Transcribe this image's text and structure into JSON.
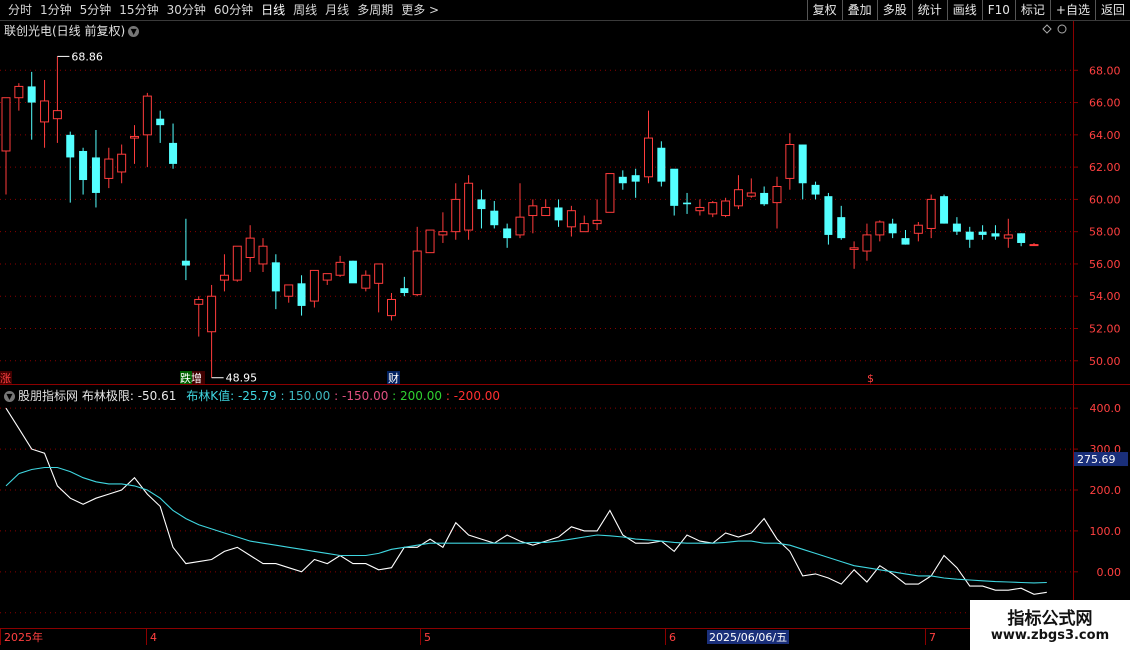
{
  "toolbar": {
    "periods": [
      "分时",
      "1分钟",
      "5分钟",
      "15分钟",
      "30分钟",
      "60分钟",
      "日线",
      "周线",
      "月线",
      "多周期",
      "更多 >"
    ],
    "active_period": "日线",
    "buttons": [
      "复权",
      "叠加",
      "多股",
      "统计",
      "画线",
      "F10",
      "标记",
      "+自选",
      "返回"
    ]
  },
  "main_title": "联创光电(日线 前复权)",
  "markers": {
    "high_label": "68.86",
    "low_label": "48.95",
    "events": [
      "涨",
      "跌增",
      "财",
      "$"
    ]
  },
  "indicator": {
    "name": "股朋指标网",
    "main_label": "布林极限: -50.61",
    "k_label": "布林K值: -25.79",
    "levels": [
      "150.00",
      "-150.00",
      "200.00",
      "-200.00"
    ],
    "current_value_tag": "275.69",
    "axis": [
      "400.0",
      "300.0",
      "200.0",
      "100.0",
      "0.00",
      "-100.0"
    ]
  },
  "date_axis": {
    "labels": [
      "2025年",
      "4",
      "5",
      "6",
      "7"
    ],
    "highlight": "2025/06/06/五"
  },
  "watermark": {
    "title": "指标公式网",
    "url": "www.zbgs3.com"
  },
  "colors": {
    "up": "#ff3c3c",
    "down": "#54ffff",
    "grid": "#8b0000",
    "line_white": "#ffffff",
    "line_cyan": "#3fd6e0"
  },
  "chart_data": [
    {
      "type": "candlestick",
      "title": "联创光电(日线 前复权)",
      "y_ticks": [
        "68.00",
        "66.00",
        "64.00",
        "62.00",
        "60.00",
        "58.00",
        "56.00",
        "54.00",
        "52.00",
        "50.00"
      ],
      "ylim": [
        48.5,
        70.0
      ],
      "ohlc": [
        [
          63.0,
          66.2,
          60.3,
          66.3
        ],
        [
          66.3,
          67.2,
          65.5,
          67.0
        ],
        [
          67.0,
          67.9,
          63.7,
          66.0
        ],
        [
          64.8,
          67.4,
          63.2,
          66.1
        ],
        [
          65.0,
          68.86,
          63.5,
          65.5
        ],
        [
          64.0,
          64.2,
          59.8,
          62.6
        ],
        [
          63.0,
          63.2,
          60.3,
          61.2
        ],
        [
          62.6,
          64.3,
          59.5,
          60.4
        ],
        [
          61.3,
          63.2,
          60.7,
          62.5
        ],
        [
          61.7,
          63.4,
          61.0,
          62.8
        ],
        [
          63.8,
          64.6,
          62.2,
          63.9
        ],
        [
          64.0,
          66.6,
          62.0,
          66.4
        ],
        [
          65.0,
          65.5,
          63.5,
          64.6
        ],
        [
          63.5,
          64.7,
          61.9,
          62.2
        ],
        [
          56.2,
          58.8,
          55.0,
          55.9
        ],
        [
          53.5,
          54.0,
          51.5,
          53.8
        ],
        [
          51.8,
          54.7,
          48.95,
          54.0
        ],
        [
          55.0,
          56.6,
          54.3,
          55.3
        ],
        [
          55.0,
          57.1,
          54.9,
          57.1
        ],
        [
          56.4,
          58.4,
          55.5,
          57.6
        ],
        [
          56.0,
          57.6,
          55.5,
          57.1
        ],
        [
          56.1,
          56.6,
          53.2,
          54.3
        ],
        [
          54.0,
          54.6,
          53.6,
          54.7
        ],
        [
          54.8,
          55.3,
          52.8,
          53.4
        ],
        [
          53.7,
          55.6,
          53.3,
          55.6
        ],
        [
          55.0,
          55.4,
          54.7,
          55.4
        ],
        [
          55.3,
          56.5,
          55.2,
          56.1
        ],
        [
          56.2,
          56.2,
          55.2,
          54.8
        ],
        [
          54.5,
          55.6,
          54.3,
          55.3
        ],
        [
          54.8,
          55.9,
          53.0,
          56.0
        ],
        [
          52.8,
          54.2,
          52.5,
          53.8
        ],
        [
          54.5,
          55.2,
          54.0,
          54.2
        ],
        [
          54.1,
          58.3,
          54.0,
          56.8
        ],
        [
          56.7,
          57.8,
          57.0,
          58.1
        ],
        [
          57.8,
          59.2,
          57.3,
          58.0
        ],
        [
          58.0,
          61.0,
          57.5,
          60.0
        ],
        [
          58.1,
          61.5,
          57.5,
          61.0
        ],
        [
          60.0,
          60.6,
          58.2,
          59.4
        ],
        [
          59.3,
          59.9,
          58.2,
          58.4
        ],
        [
          58.2,
          58.5,
          57.0,
          57.6
        ],
        [
          57.8,
          61.0,
          57.6,
          58.9
        ],
        [
          59.0,
          60.0,
          57.9,
          59.6
        ],
        [
          59.0,
          60.0,
          59.0,
          59.5
        ],
        [
          59.5,
          60.0,
          58.3,
          58.7
        ],
        [
          58.3,
          59.6,
          57.7,
          59.3
        ],
        [
          58.0,
          59.0,
          58.0,
          58.5
        ],
        [
          58.5,
          60.0,
          58.1,
          58.7
        ],
        [
          59.2,
          61.6,
          59.2,
          61.6
        ],
        [
          61.4,
          61.8,
          60.6,
          61.0
        ],
        [
          61.5,
          61.9,
          60.1,
          61.1
        ],
        [
          61.4,
          65.5,
          61.0,
          63.8
        ],
        [
          63.2,
          63.6,
          60.8,
          61.1
        ],
        [
          61.9,
          61.7,
          59.0,
          59.6
        ],
        [
          59.8,
          60.4,
          59.1,
          59.7
        ],
        [
          59.3,
          60.0,
          59.0,
          59.5
        ],
        [
          59.1,
          59.9,
          58.9,
          59.8
        ],
        [
          59.0,
          60.1,
          58.9,
          59.9
        ],
        [
          59.6,
          61.5,
          59.4,
          60.6
        ],
        [
          60.2,
          61.3,
          60.1,
          60.4
        ],
        [
          60.4,
          60.8,
          59.6,
          59.7
        ],
        [
          59.8,
          61.4,
          58.2,
          60.8
        ],
        [
          61.3,
          64.1,
          60.6,
          63.4
        ],
        [
          63.4,
          63.4,
          60.0,
          61.0
        ],
        [
          60.9,
          61.1,
          60.0,
          60.3
        ],
        [
          60.2,
          60.4,
          57.2,
          57.8
        ],
        [
          58.9,
          59.6,
          57.5,
          57.6
        ],
        [
          56.9,
          57.4,
          55.7,
          57.0
        ],
        [
          56.8,
          58.5,
          56.2,
          57.8
        ],
        [
          57.8,
          58.7,
          57.4,
          58.6
        ],
        [
          58.5,
          58.8,
          57.6,
          57.9
        ],
        [
          57.6,
          58.1,
          57.2,
          57.2
        ],
        [
          57.9,
          58.6,
          57.4,
          58.4
        ],
        [
          58.2,
          60.3,
          57.6,
          60.0
        ],
        [
          60.2,
          60.3,
          58.5,
          58.5
        ],
        [
          58.5,
          58.9,
          57.8,
          58.0
        ],
        [
          58.0,
          58.3,
          57.0,
          57.5
        ],
        [
          58.0,
          58.4,
          57.5,
          57.8
        ],
        [
          57.9,
          58.4,
          57.5,
          57.7
        ],
        [
          57.6,
          58.8,
          57.0,
          57.8
        ],
        [
          57.9,
          57.9,
          57.1,
          57.3
        ],
        [
          57.2,
          57.3,
          57.2,
          57.2
        ]
      ]
    },
    {
      "type": "line",
      "title": "布林极限 / 布林K值",
      "y_ticks": [
        "400.0",
        "300.0",
        "200.0",
        "100.0",
        "0.00",
        "-100.0"
      ],
      "ylim": [
        -130,
        420
      ],
      "series": [
        {
          "name": "布林极限",
          "color": "#ffffff",
          "values": [
            400,
            350,
            300,
            290,
            210,
            180,
            165,
            180,
            190,
            200,
            230,
            190,
            160,
            60,
            20,
            25,
            30,
            50,
            60,
            40,
            20,
            20,
            10,
            0,
            30,
            20,
            40,
            20,
            20,
            5,
            10,
            60,
            60,
            80,
            60,
            120,
            90,
            80,
            70,
            90,
            75,
            65,
            75,
            85,
            110,
            100,
            100,
            150,
            90,
            70,
            70,
            75,
            50,
            90,
            75,
            70,
            95,
            85,
            95,
            130,
            80,
            50,
            -10,
            -5,
            -15,
            -30,
            5,
            -25,
            15,
            -5,
            -30,
            -30,
            -10,
            40,
            10,
            -35,
            -35,
            -45,
            -45,
            -40,
            -55,
            -50
          ]
        },
        {
          "name": "布林K值",
          "color": "#3fd6e0",
          "values": [
            210,
            240,
            250,
            255,
            255,
            245,
            230,
            220,
            215,
            215,
            210,
            200,
            180,
            150,
            130,
            115,
            105,
            95,
            85,
            75,
            70,
            65,
            60,
            55,
            50,
            45,
            40,
            40,
            40,
            45,
            55,
            60,
            65,
            70,
            70,
            70,
            70,
            70,
            70,
            70,
            70,
            72,
            72,
            75,
            80,
            85,
            90,
            88,
            85,
            80,
            78,
            75,
            72,
            70,
            70,
            70,
            72,
            75,
            75,
            70,
            70,
            65,
            55,
            45,
            35,
            25,
            15,
            10,
            5,
            0,
            -5,
            -10,
            -10,
            -15,
            -18,
            -20,
            -22,
            -24,
            -25,
            -26,
            -27,
            -26
          ]
        }
      ]
    }
  ]
}
